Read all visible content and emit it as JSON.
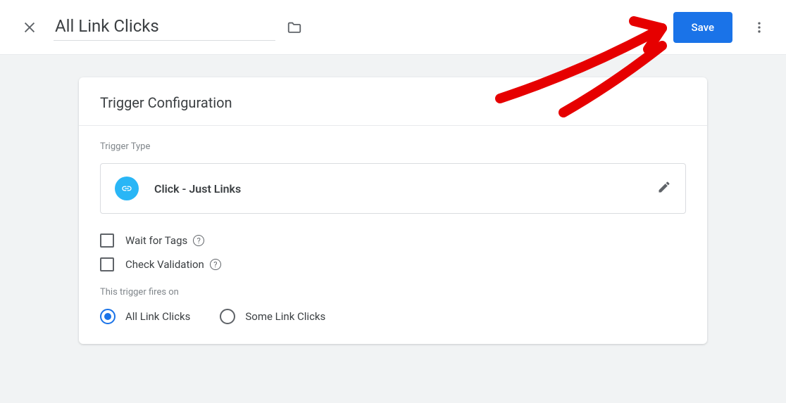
{
  "header": {
    "title": "All Link Clicks",
    "save_label": "Save"
  },
  "card": {
    "title": "Trigger Configuration",
    "trigger_type_label": "Trigger Type",
    "trigger_type_value": "Click - Just Links",
    "checkboxes": {
      "wait_for_tags": "Wait for Tags",
      "check_validation": "Check Validation"
    },
    "fires_on": {
      "label": "This trigger fires on",
      "options": {
        "all": "All Link Clicks",
        "some": "Some Link Clicks"
      }
    }
  }
}
